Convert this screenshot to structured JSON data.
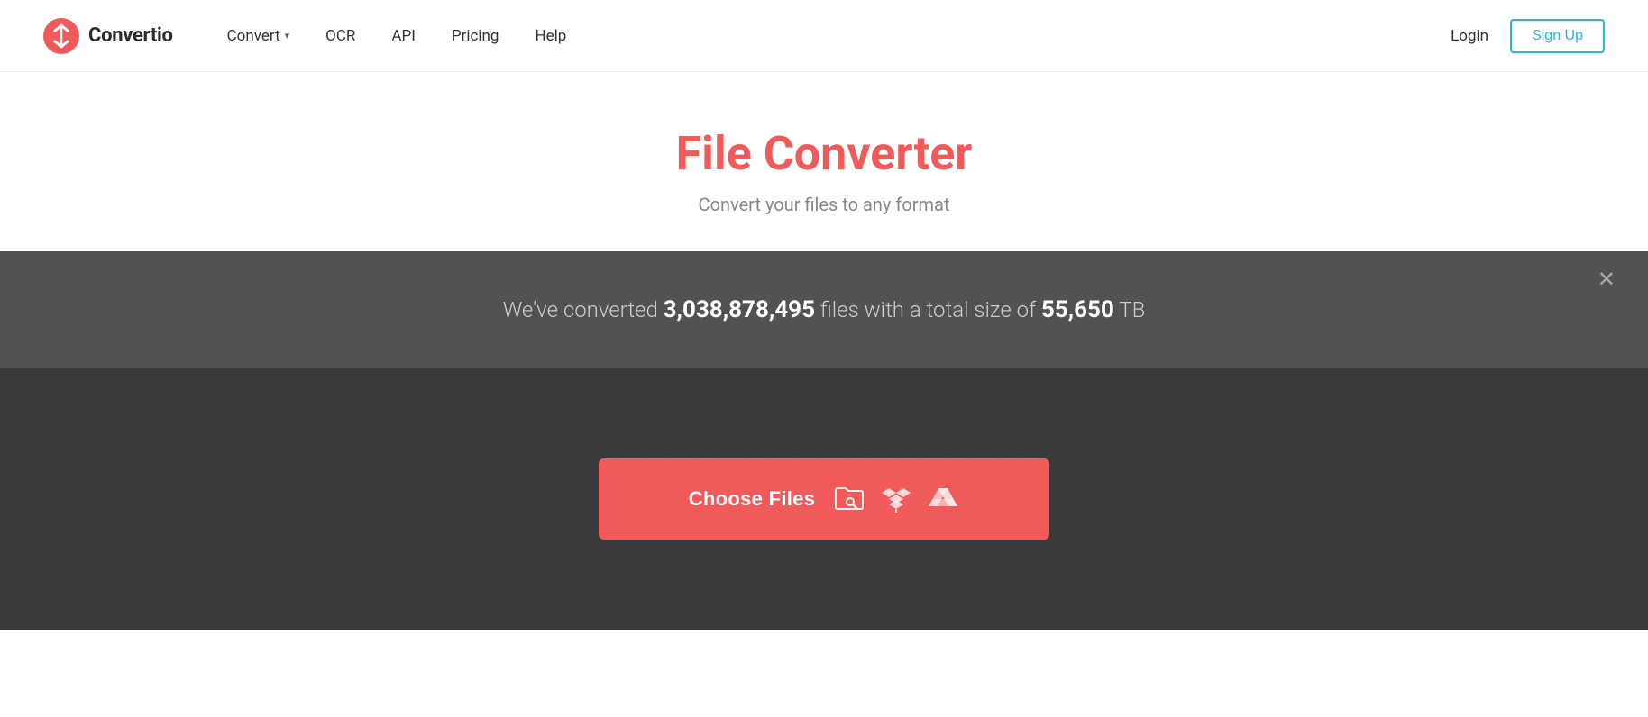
{
  "brand": {
    "name": "Convertio",
    "logo_alt": "Convertio logo"
  },
  "nav": {
    "convert_label": "Convert",
    "ocr_label": "OCR",
    "api_label": "API",
    "pricing_label": "Pricing",
    "help_label": "Help",
    "login_label": "Login",
    "signup_label": "Sign Up"
  },
  "hero": {
    "title": "File Converter",
    "subtitle": "Convert your files to any format"
  },
  "stats": {
    "prefix": "We've converted ",
    "count": "3,038,878,495",
    "middle": " files with a total size of ",
    "size": "55,650",
    "suffix": " TB"
  },
  "upload": {
    "choose_files_label": "Choose Files"
  },
  "colors": {
    "brand_red": "#f05a5a",
    "brand_teal": "#29b6d8"
  }
}
